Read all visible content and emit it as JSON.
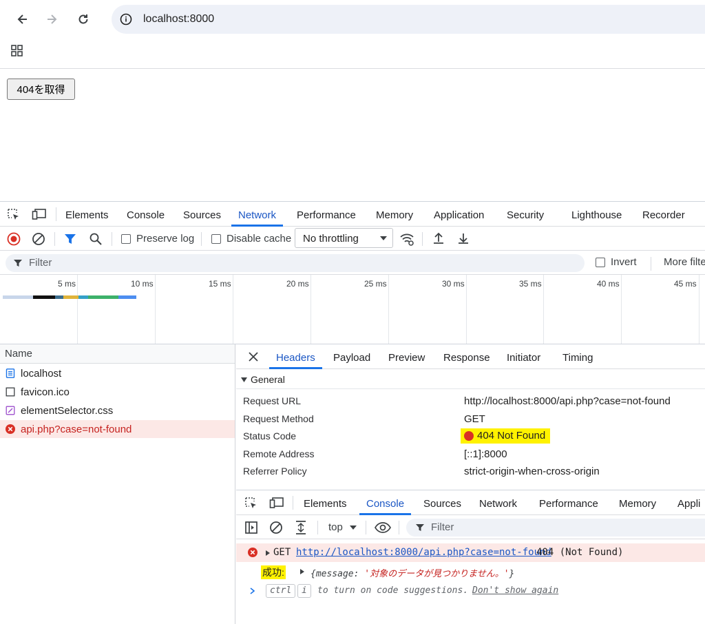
{
  "browser": {
    "url": "localhost:8000"
  },
  "page": {
    "button_label": "404を取得"
  },
  "devtools": {
    "tabs": [
      "Elements",
      "Console",
      "Sources",
      "Network",
      "Performance",
      "Memory",
      "Application",
      "Security",
      "Lighthouse",
      "Recorder"
    ],
    "active_tab": "Network",
    "toolbar": {
      "preserve_log": "Preserve log",
      "disable_cache": "Disable cache",
      "throttling": "No throttling"
    },
    "filter": {
      "placeholder": "Filter",
      "invert": "Invert",
      "more_filters": "More filte"
    },
    "timeline_ticks": [
      "5 ms",
      "10 ms",
      "15 ms",
      "20 ms",
      "25 ms",
      "30 ms",
      "35 ms",
      "40 ms",
      "45 ms"
    ],
    "requests": {
      "header": "Name",
      "items": [
        {
          "name": "localhost",
          "type": "document"
        },
        {
          "name": "favicon.ico",
          "type": "other"
        },
        {
          "name": "elementSelector.css",
          "type": "stylesheet"
        },
        {
          "name": "api.php?case=not-found",
          "type": "error"
        }
      ]
    },
    "detail": {
      "tabs": [
        "Headers",
        "Payload",
        "Preview",
        "Response",
        "Initiator",
        "Timing"
      ],
      "active_tab": "Headers",
      "section": "General",
      "rows": [
        {
          "label": "Request URL",
          "value": "http://localhost:8000/api.php?case=not-found"
        },
        {
          "label": "Request Method",
          "value": "GET"
        },
        {
          "label": "Status Code",
          "value": "404 Not Found"
        },
        {
          "label": "Remote Address",
          "value": "[::1]:8000"
        },
        {
          "label": "Referrer Policy",
          "value": "strict-origin-when-cross-origin"
        }
      ]
    },
    "drawer": {
      "tabs": [
        "Elements",
        "Console",
        "Sources",
        "Network",
        "Performance",
        "Memory",
        "Appli"
      ],
      "active_tab": "Console",
      "context": "top",
      "filter": "Filter",
      "error": {
        "method": "GET",
        "url": "http://localhost:8000/api.php?case=not-found",
        "status": "404 (Not Found)"
      },
      "log": {
        "label": "成功:",
        "object_prefix": "{message: ",
        "object_value": "'対象のデータが見つかりません。'",
        "object_suffix": "}"
      },
      "hint": {
        "key1": "ctrl",
        "key2": "i",
        "text": "to turn on code suggestions.",
        "link": "Don't show again"
      }
    },
    "colors": {
      "accent": "#1a73e8",
      "error": "#d93025",
      "error_bg": "#fce8e6",
      "highlight": "#fff200"
    }
  }
}
